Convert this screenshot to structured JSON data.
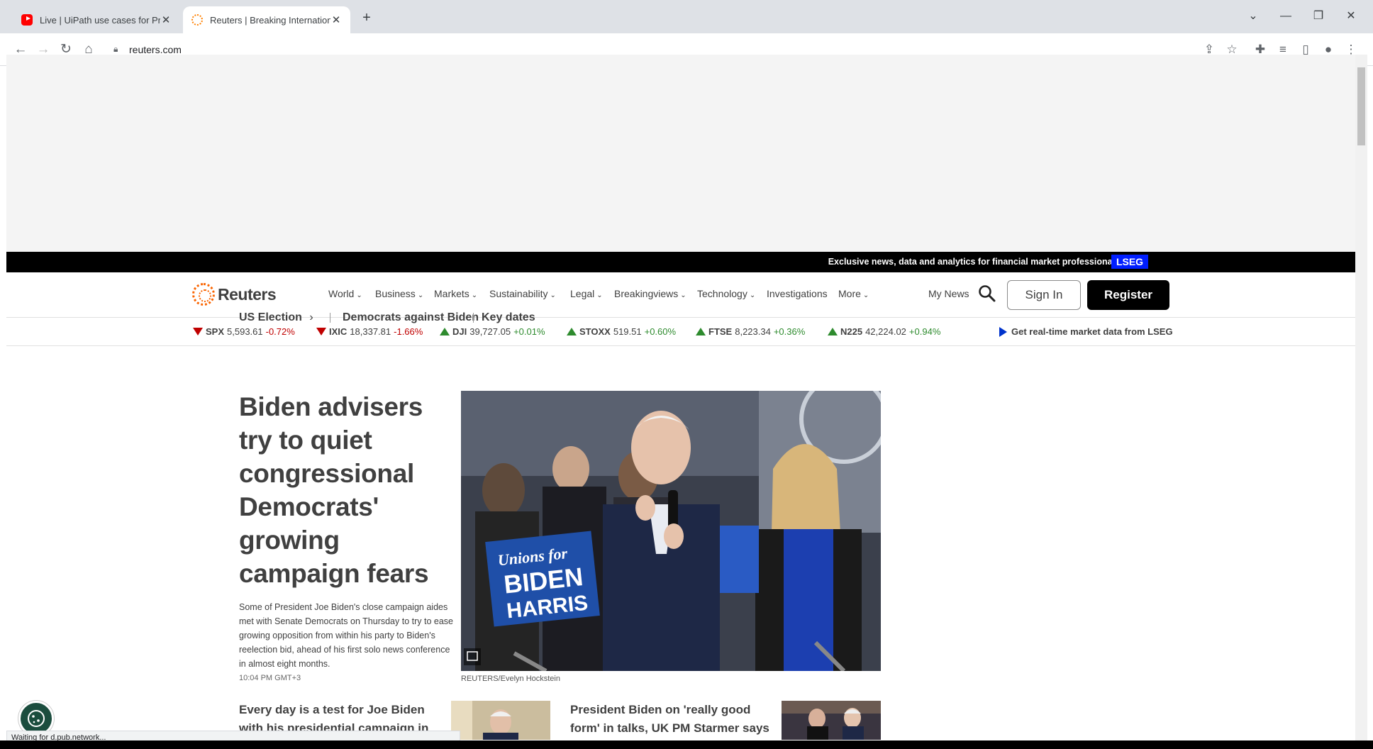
{
  "browser": {
    "tabs": [
      {
        "title": "Live | UiPath use cases for Practic",
        "favicon": "youtube-icon",
        "active": false
      },
      {
        "title": "Reuters | Breaking International N",
        "favicon": "reuters-icon",
        "active": true
      }
    ],
    "new_tab_symbol": "+",
    "close_symbol": "✕",
    "url": "reuters.com",
    "status": "Waiting for d.pub.network..."
  },
  "promo": {
    "text": "Exclusive news, data and analytics for financial market professionals",
    "badge": "LSEG"
  },
  "header": {
    "brand": "Reuters",
    "nav": [
      {
        "label": "World",
        "has_menu": true
      },
      {
        "label": "Business",
        "has_menu": true
      },
      {
        "label": "Markets",
        "has_menu": true
      },
      {
        "label": "Sustainability",
        "has_menu": true
      },
      {
        "label": "Legal",
        "has_menu": true
      },
      {
        "label": "Breakingviews",
        "has_menu": true
      },
      {
        "label": "Technology",
        "has_menu": true
      },
      {
        "label": "Investigations",
        "has_menu": false
      },
      {
        "label": "More",
        "has_menu": true
      }
    ],
    "my_news": "My News",
    "sign_in": "Sign In",
    "register": "Register"
  },
  "ticker": [
    {
      "symbol": "SPX",
      "value": "5,593.61",
      "change": "-0.72%",
      "direction": "down"
    },
    {
      "symbol": "IXIC",
      "value": "18,337.81",
      "change": "-1.66%",
      "direction": "down"
    },
    {
      "symbol": "DJI",
      "value": "39,727.05",
      "change": "+0.01%",
      "direction": "up"
    },
    {
      "symbol": "STOXX",
      "value": "519.51",
      "change": "+0.60%",
      "direction": "up"
    },
    {
      "symbol": "FTSE",
      "value": "8,223.34",
      "change": "+0.36%",
      "direction": "up"
    },
    {
      "symbol": "N225",
      "value": "42,224.02",
      "change": "+0.94%",
      "direction": "up"
    }
  ],
  "lseg_link": "Get real-time market data from LSEG",
  "topics": {
    "primary": "US Election",
    "items": [
      "Democrats against Biden",
      "Key dates"
    ]
  },
  "lead": {
    "headline": "Biden advisers try to quiet congressional Democrats' growing campaign fears",
    "summary": "Some of President Joe Biden's close campaign aides met with Senate Democrats on Thursday to try to ease growing opposition from within his party to Biden's reelection bid, ahead of his first solo news conference in almost eight months.",
    "timestamp": "10:04 PM GMT+3",
    "caption": "REUTERS/Evelyn Hockstein",
    "sign_text_1": "Unions for",
    "sign_text_2": "BIDEN",
    "sign_text_3": "HARRIS"
  },
  "secondary": [
    {
      "headline": "Every day is a test for Joe Biden with his presidential campaign in"
    },
    {
      "headline": "President Biden on 'really good form' in talks, UK PM Starmer says"
    }
  ],
  "colors": {
    "brand_orange": "#fa6400",
    "lseg_blue": "#001eff",
    "down_red": "#c00000",
    "up_green": "#2e8b2e"
  }
}
